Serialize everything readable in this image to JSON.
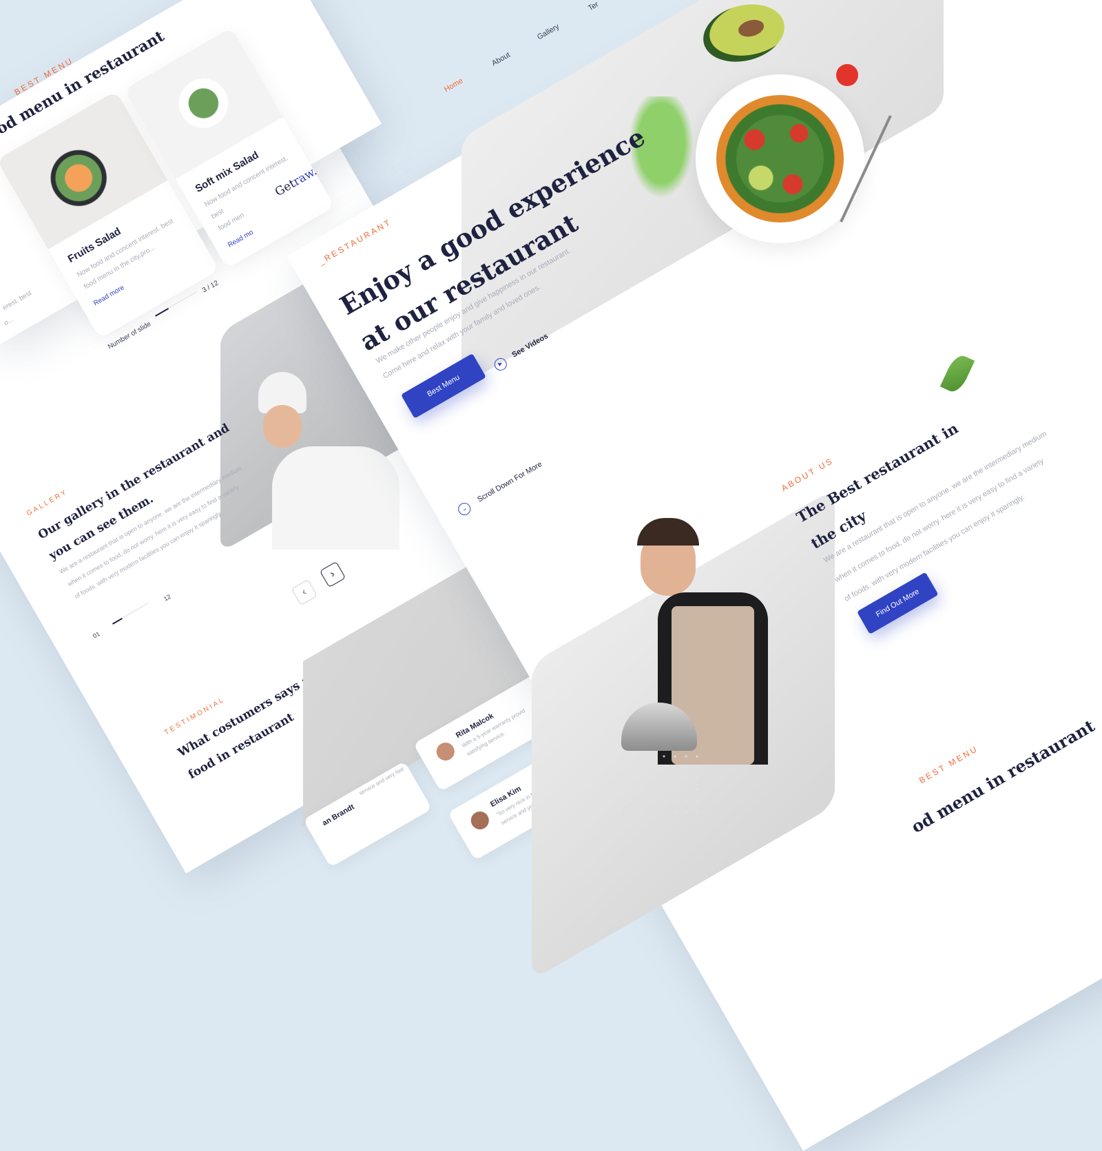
{
  "brand": {
    "logo_part1": "Get",
    "logo_part2": "raw."
  },
  "nav": {
    "home": "Home",
    "about": "About",
    "gallery": "Gallery",
    "more": "Ter"
  },
  "hero": {
    "eyebrow": "_RESTAURANT",
    "title_line1": "Enjoy a good experience",
    "title_line2": "at our restaurant",
    "desc_line1": "We make other people enjoy and give happiness in our restaurant.",
    "desc_line2": "Come here and relax with your family and loved ones.",
    "primary_button": "Best Menu",
    "video_link": "See Videos",
    "scroll_label": "Scroll Down For More"
  },
  "menu_section": {
    "eyebrow": "BEST MENU",
    "title": "od menu in restaurant",
    "cards": [
      {
        "title": "Fruits Salad",
        "desc_line1": "Now food and concent interest. best",
        "desc_line2": "food menu in the city,pro...",
        "link": "Read more"
      },
      {
        "title": "Soft mix Salad",
        "desc_line1": "Now food and concent interest. best",
        "desc_line2": "food men",
        "link": "Read mo"
      }
    ],
    "partial_desc_line1": "erest. best",
    "partial_desc_line2": "o...",
    "slide_label": "Number of slide",
    "slide_count": "3 / 12"
  },
  "gallery": {
    "eyebrow": "GALLERY",
    "title_line1": "Our gallery in the restaurant and",
    "title_line2": "you can see them.",
    "desc_line1": "We are a restaurant that is open to anyone. we are the intermediary medium",
    "desc_line2": "when it comes to food, do not worry. here it is very easy to find a variety",
    "desc_line3": "of foods. with very modern facilities you can enjoy it sparingly.",
    "page_start": "01",
    "page_end": "12",
    "prev_label": "‹",
    "next_label": "›"
  },
  "testimonial": {
    "eyebrow": "TESTIMONIAL",
    "title_line1": "What costumers says about best",
    "title_line2": "food in restaurant",
    "reviews": [
      {
        "name": "Rita Malcok",
        "text_line1": "With a 5-year warranty provid",
        "text_line2": "satisfying service."
      },
      {
        "name": "Elisa Kim",
        "text_line1": "\"So very nice in this restaurant,",
        "text_line2": "service and you don't have"
      },
      {
        "name": "an Brandt",
        "text_line1": "service and very fast",
        "text_line2": ""
      }
    ]
  },
  "about": {
    "eyebrow": "ABOUT US",
    "title_line1": "The Best restaurant in",
    "title_line2": "the city",
    "desc_line1": "We are a restaurant that is open to anyone. we are the intermediary medium",
    "desc_line2": "when it comes to food, do not worry. here it is very easy to find a variety",
    "desc_line3": "of foods. with very modern facilities you can enjoy it sparingly.",
    "button": "Find Out More"
  },
  "best_menu_bottom": {
    "eyebrow": "BEST MENU",
    "title": "od menu in restaurant"
  },
  "colors": {
    "accent": "#f26b3a",
    "primary": "#2f43c3",
    "heading": "#1f2240",
    "background": "#dde9f2"
  },
  "icons": [
    "play-icon",
    "chevron-down-icon",
    "chevron-left-icon",
    "chevron-right-icon",
    "leaf-icon"
  ]
}
